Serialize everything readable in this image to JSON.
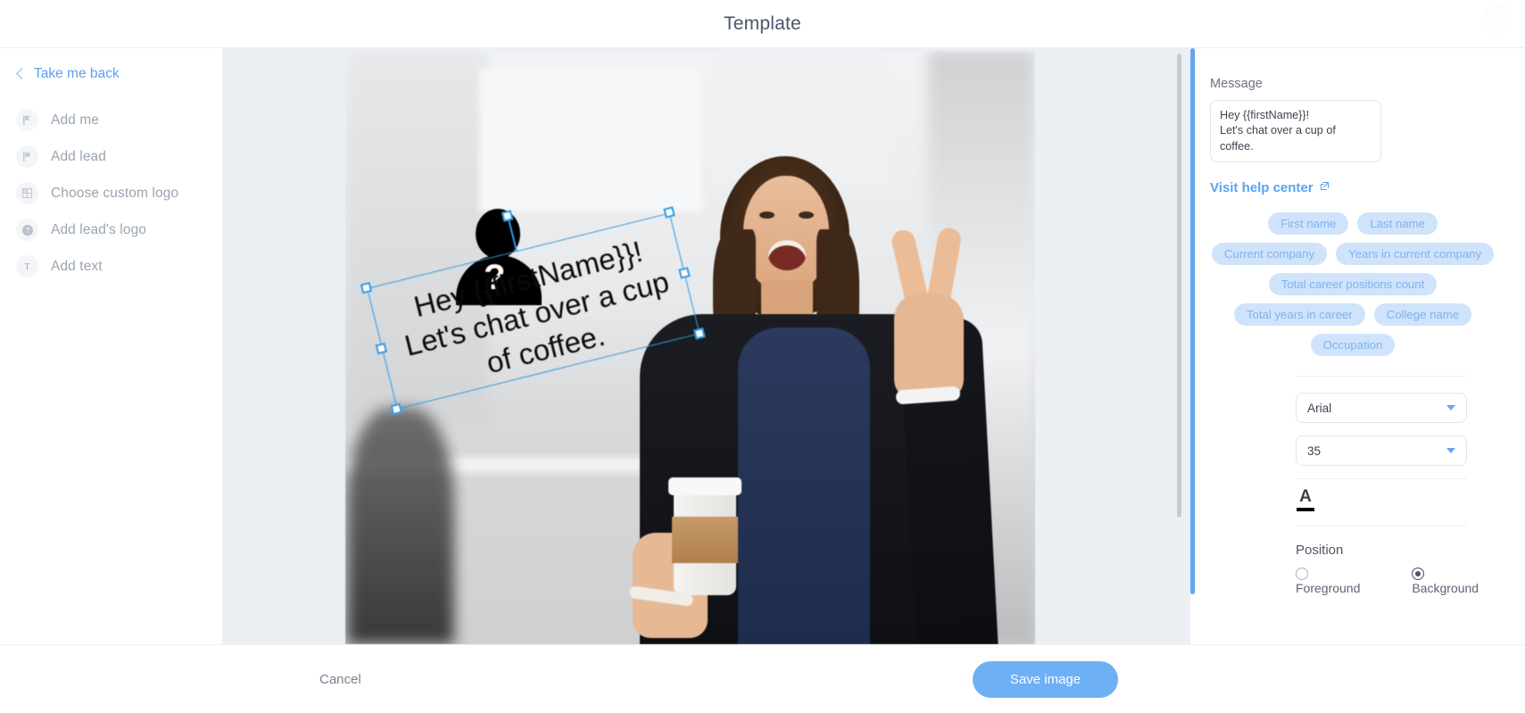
{
  "header": {
    "title": "Template",
    "close_icon": "close-icon"
  },
  "sidebar": {
    "back_label": "Take me back",
    "items": [
      {
        "label": "Add me",
        "icon": "add-me-icon"
      },
      {
        "label": "Add lead",
        "icon": "add-lead-icon"
      },
      {
        "label": "Choose custom logo",
        "icon": "custom-logo-icon"
      },
      {
        "label": "Add lead's logo",
        "icon": "lead-logo-icon"
      },
      {
        "label": "Add text",
        "icon": "add-text-icon"
      }
    ]
  },
  "canvas": {
    "overlay_text": "Hey  {{firstName}}!\nLet's chat over a cup of coffee.",
    "avatar_placeholder_icon": "person-question-icon",
    "selection_handles": 8,
    "rotation_deg": -14
  },
  "right_panel": {
    "message_label": "Message",
    "message_value": "Hey  {{firstName}}!\nLet's chat over a cup of coffee.",
    "help_link_label": "Visit help center",
    "help_link_icon": "external-link-icon",
    "tags": [
      "First name",
      "Last name",
      "Current company",
      "Years in current company",
      "Total career positions count",
      "Total years in career",
      "College name",
      "Occupation"
    ],
    "font_family_value": "Arial",
    "font_size_value": "35",
    "text_color_icon": "text-color-icon",
    "align_icons": [
      "align-left-icon",
      "align-center-icon",
      "align-right-icon"
    ],
    "position_label": "Position",
    "position_options": [
      {
        "label": "Foreground",
        "selected": false
      },
      {
        "label": "Background",
        "selected": true
      }
    ]
  },
  "footer": {
    "cancel_label": "Cancel",
    "save_label": "Save image"
  },
  "colors": {
    "accent_blue": "#6eb0f5",
    "link_blue": "#5aa2f0",
    "tag_bg": "#cfe3fb",
    "tag_text": "#7fb2ee",
    "canvas_bg": "#eceff3",
    "selection_blue": "#2f9ae8"
  }
}
